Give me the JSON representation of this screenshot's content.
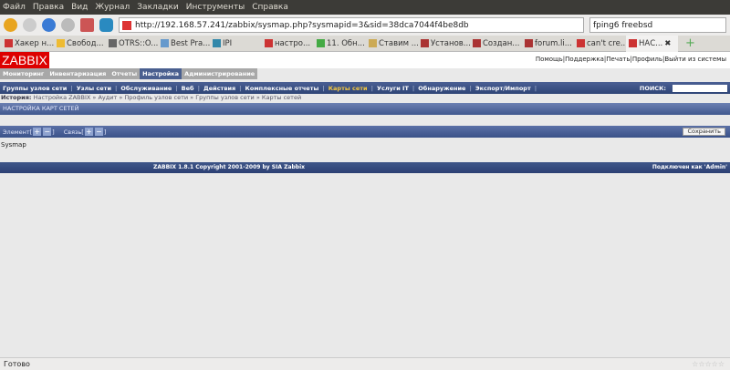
{
  "browser": {
    "menu": [
      "Файл",
      "Правка",
      "Вид",
      "Журнал",
      "Закладки",
      "Инструменты",
      "Справка"
    ],
    "url": "http://192.168.57.241/zabbix/sysmap.php?sysmapid=3&sid=38dca7044f4be8db",
    "search": "fping6 freebsd",
    "tabs": [
      "Хакер н...",
      "Свобод...",
      "OTRS::O...",
      "Best Pra...",
      "IPI",
      "настро...",
      "11. Обн...",
      "Ставим ...",
      "Установ...",
      "Создан...",
      "forum.li...",
      "can't cre...",
      "НАС..."
    ],
    "status": "Готово",
    "rating": "☆☆☆☆☆"
  },
  "zabbix": {
    "logo": "ZABBIX",
    "toplinks": [
      "Помощь",
      "Поддержка",
      "Печать",
      "Профиль",
      "Выйти из системы"
    ],
    "mainmenu": [
      "Мониторинг",
      "Инвентаризация",
      "Отчеты",
      "Настройка",
      "Администрирование"
    ],
    "submenu": [
      "Группы узлов сети",
      "Узлы сети",
      "Обслуживание",
      "Веб",
      "Действия",
      "Комплексные отчеты",
      "Карты сети",
      "Услуги IT",
      "Обнаружение",
      "Экспорт/Импорт"
    ],
    "search_label": "ПОИСК:",
    "history_label": "История:",
    "history": [
      "Настройка ZABBIX",
      "Аудит",
      "Профиль узлов сети",
      "Группы узлов сети",
      "Карты сетей"
    ],
    "title": "НАСТРОЙКА КАРТ СЕТЕЙ",
    "element_label": "Элемент[",
    "link_label": "Связь[",
    "close": "]",
    "plus": "+",
    "minus": "−",
    "save": "Сохранить",
    "map_name": "Sysmap",
    "copyright": "ZABBIX 1.8.1 Copyright 2001-2009 by SIA Zabbix",
    "connected": "Подключен как 'Admin'"
  }
}
